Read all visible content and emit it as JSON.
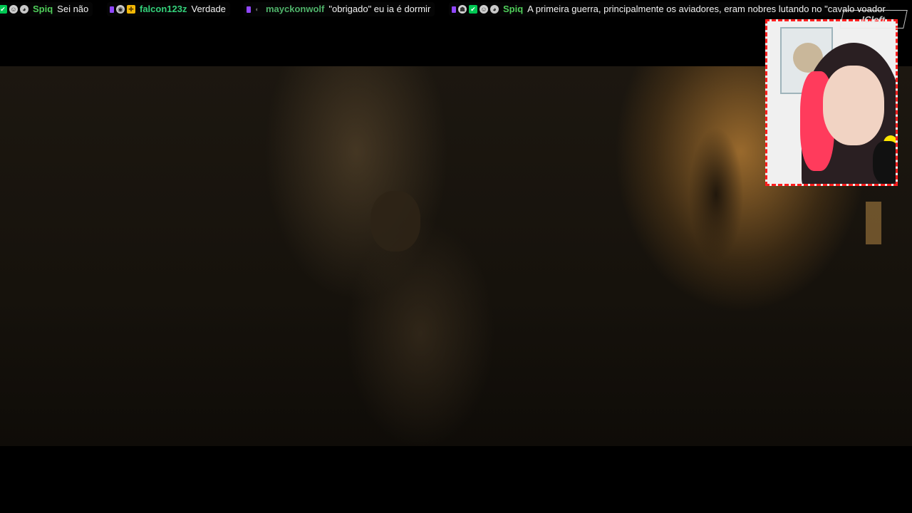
{
  "chat_ticker": {
    "messages": [
      {
        "user": "Spiq",
        "user_color": "#4fcf5a",
        "text": "Sei não",
        "badges": [
          "purple-badge-icon",
          "checkmark-badge-icon",
          "robot-badge-icon",
          "face-badge-icon"
        ]
      },
      {
        "user": "falcon123z",
        "user_color": "#33d17a",
        "text": "Verdade",
        "badges": [
          "purple-badge-icon",
          "avatar-badge-icon",
          "gift-badge-icon"
        ]
      },
      {
        "user": "mayckonwolf",
        "user_color": "#4fb36a",
        "text": "\"obrigado\" eu ia é dormir",
        "badges": [
          "purple-badge-icon",
          "moon-badge-icon"
        ]
      },
      {
        "user": "Spiq",
        "user_color": "#4fcf5a",
        "text": "A primeira guerra, principalmente os aviadores, eram nobres lutando no \"cavalo voador",
        "badges": [
          "purple-badge-icon",
          "ghost-badge-icon",
          "checkmark-badge-icon",
          "robot-badge-icon",
          "face-badge-icon"
        ]
      }
    ]
  },
  "webcam": {
    "border_color": "#ff1e1e"
  },
  "watermark": {
    "text": "ICleft"
  }
}
